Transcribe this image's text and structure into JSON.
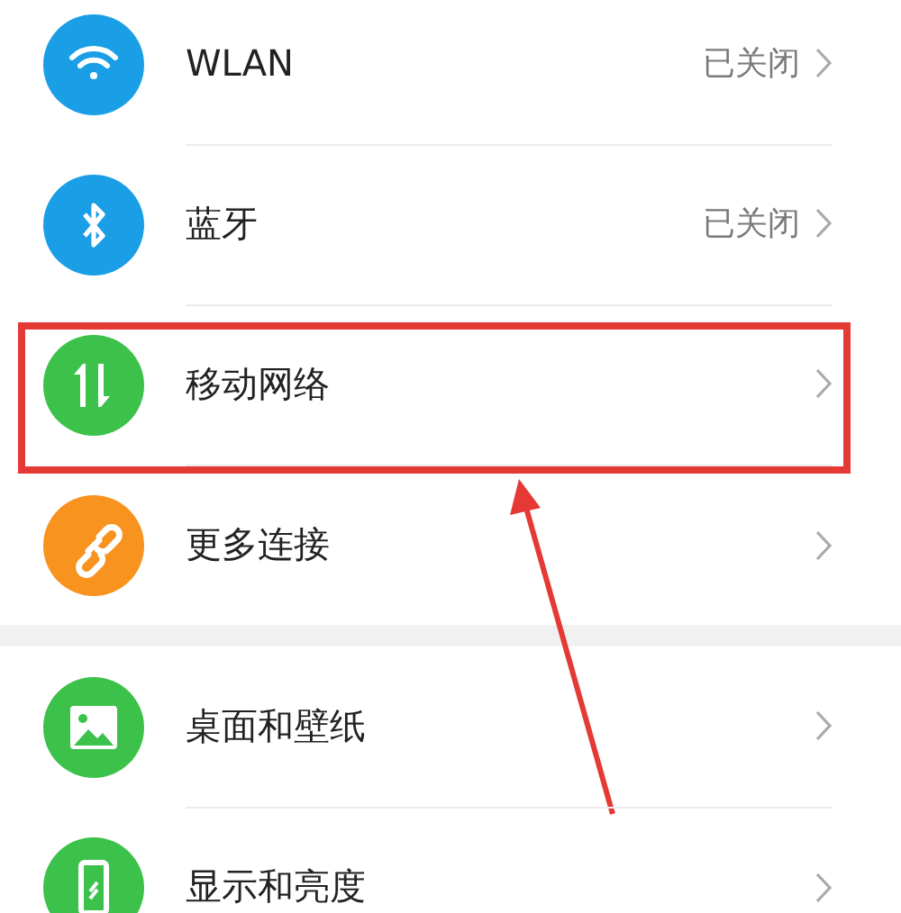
{
  "groups": [
    {
      "items": [
        {
          "kind": "wifi",
          "label": "WLAN",
          "value": "已关闭",
          "annotated": false
        },
        {
          "kind": "bluetooth",
          "label": "蓝牙",
          "value": "已关闭",
          "annotated": false
        },
        {
          "kind": "data",
          "label": "移动网络",
          "annotated": true
        },
        {
          "kind": "link",
          "label": "更多连接",
          "annotated": false
        }
      ]
    },
    {
      "items": [
        {
          "kind": "image",
          "label": "桌面和壁纸",
          "annotated": false
        },
        {
          "kind": "phone",
          "label": "显示和亮度",
          "annotated": false
        }
      ]
    }
  ]
}
